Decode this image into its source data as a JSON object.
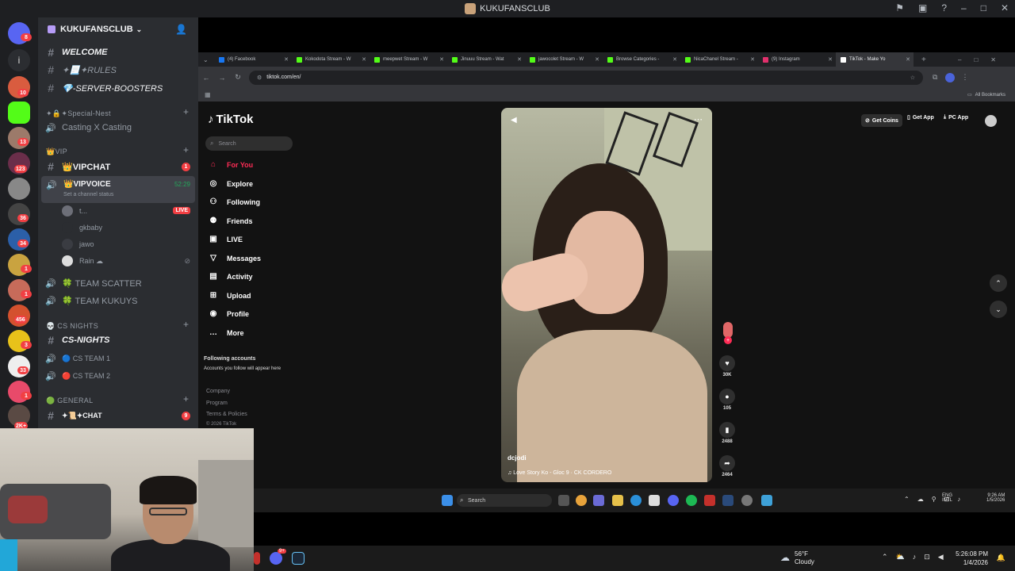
{
  "discord": {
    "title": "KUKUFANSCLUB",
    "server_name": "KUKUFANSCLUB",
    "rail_badges": [
      "8",
      "10",
      "13",
      "123",
      "36",
      "34",
      "1",
      "1",
      "456",
      "3",
      "33",
      "1",
      "2K+"
    ],
    "channels": {
      "welcome": "WELCOME",
      "rules": "✦📃✦RULES",
      "boosters": "💎-SERVER-BOOSTERS",
      "cat_special": "✦🔒✦Special-Nest",
      "casting": "Casting X Casting",
      "cat_vip": "👑VIP",
      "vipchat": "👑VIPCHAT",
      "vipchat_badge": "1",
      "vipvoice": "👑VIPVOICE",
      "vipvoice_timer": "52:29",
      "vipvoice_status": "Set a channel status",
      "voice_users": [
        "t...",
        "gkbaby",
        "jawo",
        "Rain ☁"
      ],
      "live": "LIVE",
      "team_scatter": "🍀 TEAM SCATTER",
      "team_kukuys": "🍀 TEAM KUKUYS",
      "cat_cs": "💀 CS NIGHTS",
      "cs_nights": "CS-NIGHTS",
      "cs_team1": "🔵 CS TEAM 1",
      "cs_team2": "🔴 CS TEAM 2",
      "cat_general": "🟢 GENERAL",
      "chat": "✦📜✦CHAT",
      "chat_badge": "9"
    }
  },
  "browser": {
    "tabs": [
      {
        "label": "(4) Facebook",
        "color": "#1877f2"
      },
      {
        "label": "Kokodota Stream - W",
        "color": "#53fc18"
      },
      {
        "label": "meepwet Stream - W",
        "color": "#53fc18"
      },
      {
        "label": "Jinuuu Stream - Wat",
        "color": "#53fc18"
      },
      {
        "label": "jawocolet Stream - W",
        "color": "#53fc18"
      },
      {
        "label": "Browse Categories - ",
        "color": "#53fc18"
      },
      {
        "label": "NicaChanel Stream - ",
        "color": "#53fc18"
      },
      {
        "label": "(9) Instagram",
        "color": "#e1306c"
      },
      {
        "label": "TikTok - Make Yo",
        "color": "#ffffff"
      }
    ],
    "url": "tiktok.com/en/",
    "bookmarks": "All Bookmarks"
  },
  "tiktok": {
    "logo": "TikTok",
    "search_placeholder": "Search",
    "nav": [
      {
        "icon": "home-icon",
        "label": "For You"
      },
      {
        "icon": "compass-icon",
        "label": "Explore"
      },
      {
        "icon": "following-icon",
        "label": "Following"
      },
      {
        "icon": "friends-icon",
        "label": "Friends"
      },
      {
        "icon": "live-icon",
        "label": "LIVE"
      },
      {
        "icon": "messages-icon",
        "label": "Messages"
      },
      {
        "icon": "activity-icon",
        "label": "Activity"
      },
      {
        "icon": "upload-icon",
        "label": "Upload"
      },
      {
        "icon": "profile-icon",
        "label": "Profile"
      },
      {
        "icon": "more-icon",
        "label": "More"
      }
    ],
    "following_title": "Following accounts",
    "following_sub": "Accounts you follow will appear here",
    "footer": [
      "Company",
      "Program",
      "Terms & Policies",
      "© 2026 TikTok"
    ],
    "top": {
      "get_coins": "Get Coins",
      "get_app": "Get App",
      "pc_app": "PC App"
    },
    "video": {
      "username": "dcjodi",
      "song": "Love Story Ko - Gloc 9 · CK CORDERO"
    },
    "counts": {
      "likes": "30K",
      "comments": "105",
      "saves": "2488",
      "shares": "2464"
    }
  },
  "inner_taskbar": {
    "search": "Search",
    "lang": "ENG",
    "lang2": "INTL",
    "time": "9:26 AM",
    "date": "1/5/2026"
  },
  "outer_taskbar": {
    "temp": "56°F",
    "weather": "Cloudy",
    "time": "5:26:08 PM",
    "date": "1/4/2026",
    "discord_badge": "9+"
  }
}
